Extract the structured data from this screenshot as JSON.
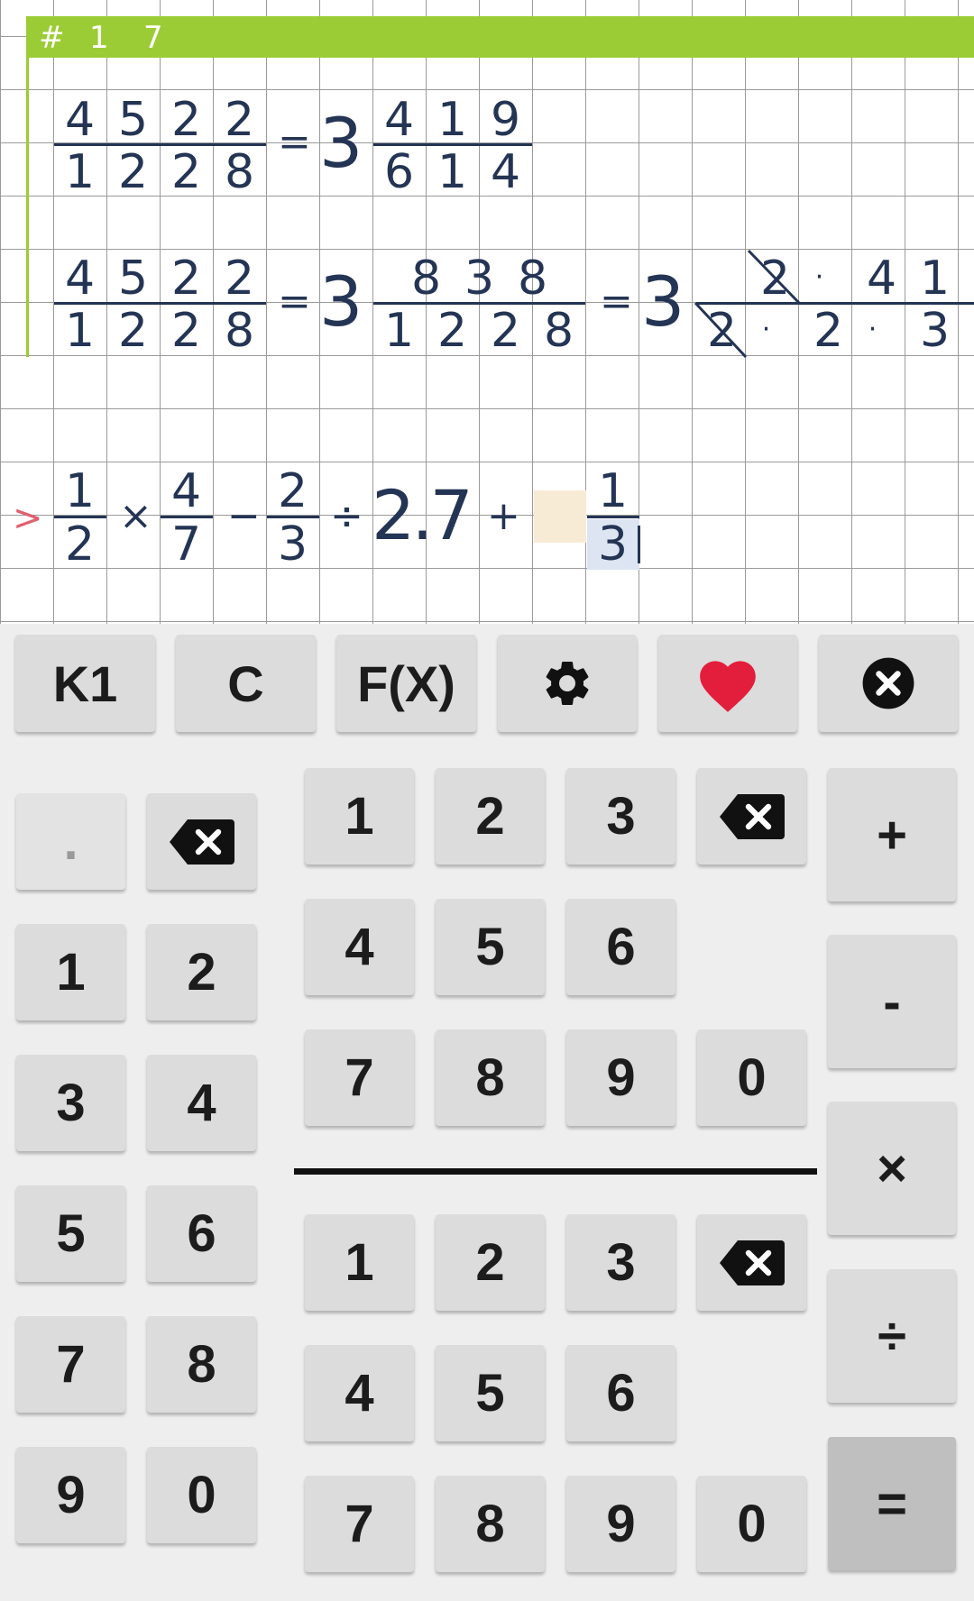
{
  "header": {
    "hash": "#",
    "n1": "1",
    "n2": "7"
  },
  "line1": {
    "num": [
      "4",
      "5",
      "2",
      "2"
    ],
    "den": [
      "1",
      "2",
      "2",
      "8"
    ],
    "eq": "=",
    "whole": "3",
    "rnum": [
      "4",
      "1",
      "9"
    ],
    "rden": [
      "6",
      "1",
      "4"
    ]
  },
  "line2": {
    "num": [
      "4",
      "5",
      "2",
      "2"
    ],
    "den": [
      "1",
      "2",
      "2",
      "8"
    ],
    "eq1": "=",
    "whole1": "3",
    "mnum": [
      "8",
      "3",
      "8"
    ],
    "mden": [
      "1",
      "2",
      "2",
      "8"
    ],
    "eq2": "=",
    "whole2": "3",
    "fnum": [
      "2",
      "·",
      "4",
      "1"
    ],
    "fden": [
      "2",
      "·",
      "2",
      "·",
      "3"
    ]
  },
  "input_line": {
    "prompt": ">",
    "f1": {
      "num": "1",
      "den": "2"
    },
    "times": "×",
    "f2": {
      "num": "4",
      "den": "7"
    },
    "minus": "−",
    "f3": {
      "num": "2",
      "den": "3"
    },
    "divide": "÷",
    "decimal": "2.7",
    "plus": "+",
    "f4": {
      "num": "1",
      "den": "3"
    }
  },
  "keyboard": {
    "top_row": {
      "k1": "K1",
      "clear": "C",
      "fx": "F(X)",
      "settings_icon": "gear-icon",
      "favorite_icon": "heart-icon",
      "close_icon": "close-circle-icon"
    },
    "left_pad": {
      "dot": ".",
      "keys": [
        "1",
        "2",
        "3",
        "4",
        "5",
        "6",
        "7",
        "8",
        "9",
        "0"
      ]
    },
    "numerator_pad": [
      "1",
      "2",
      "3",
      "4",
      "5",
      "6",
      "7",
      "8",
      "9",
      "0"
    ],
    "denominator_pad": [
      "1",
      "2",
      "3",
      "4",
      "5",
      "6",
      "7",
      "8",
      "9",
      "0"
    ],
    "operators": {
      "plus": "+",
      "minus": "-",
      "times": "×",
      "divide": "÷",
      "equals": "="
    }
  },
  "colors": {
    "header_green": "#9ccc35",
    "ink": "#243454",
    "heart_red": "#e31e3c",
    "prompt_pink": "#e06070"
  }
}
